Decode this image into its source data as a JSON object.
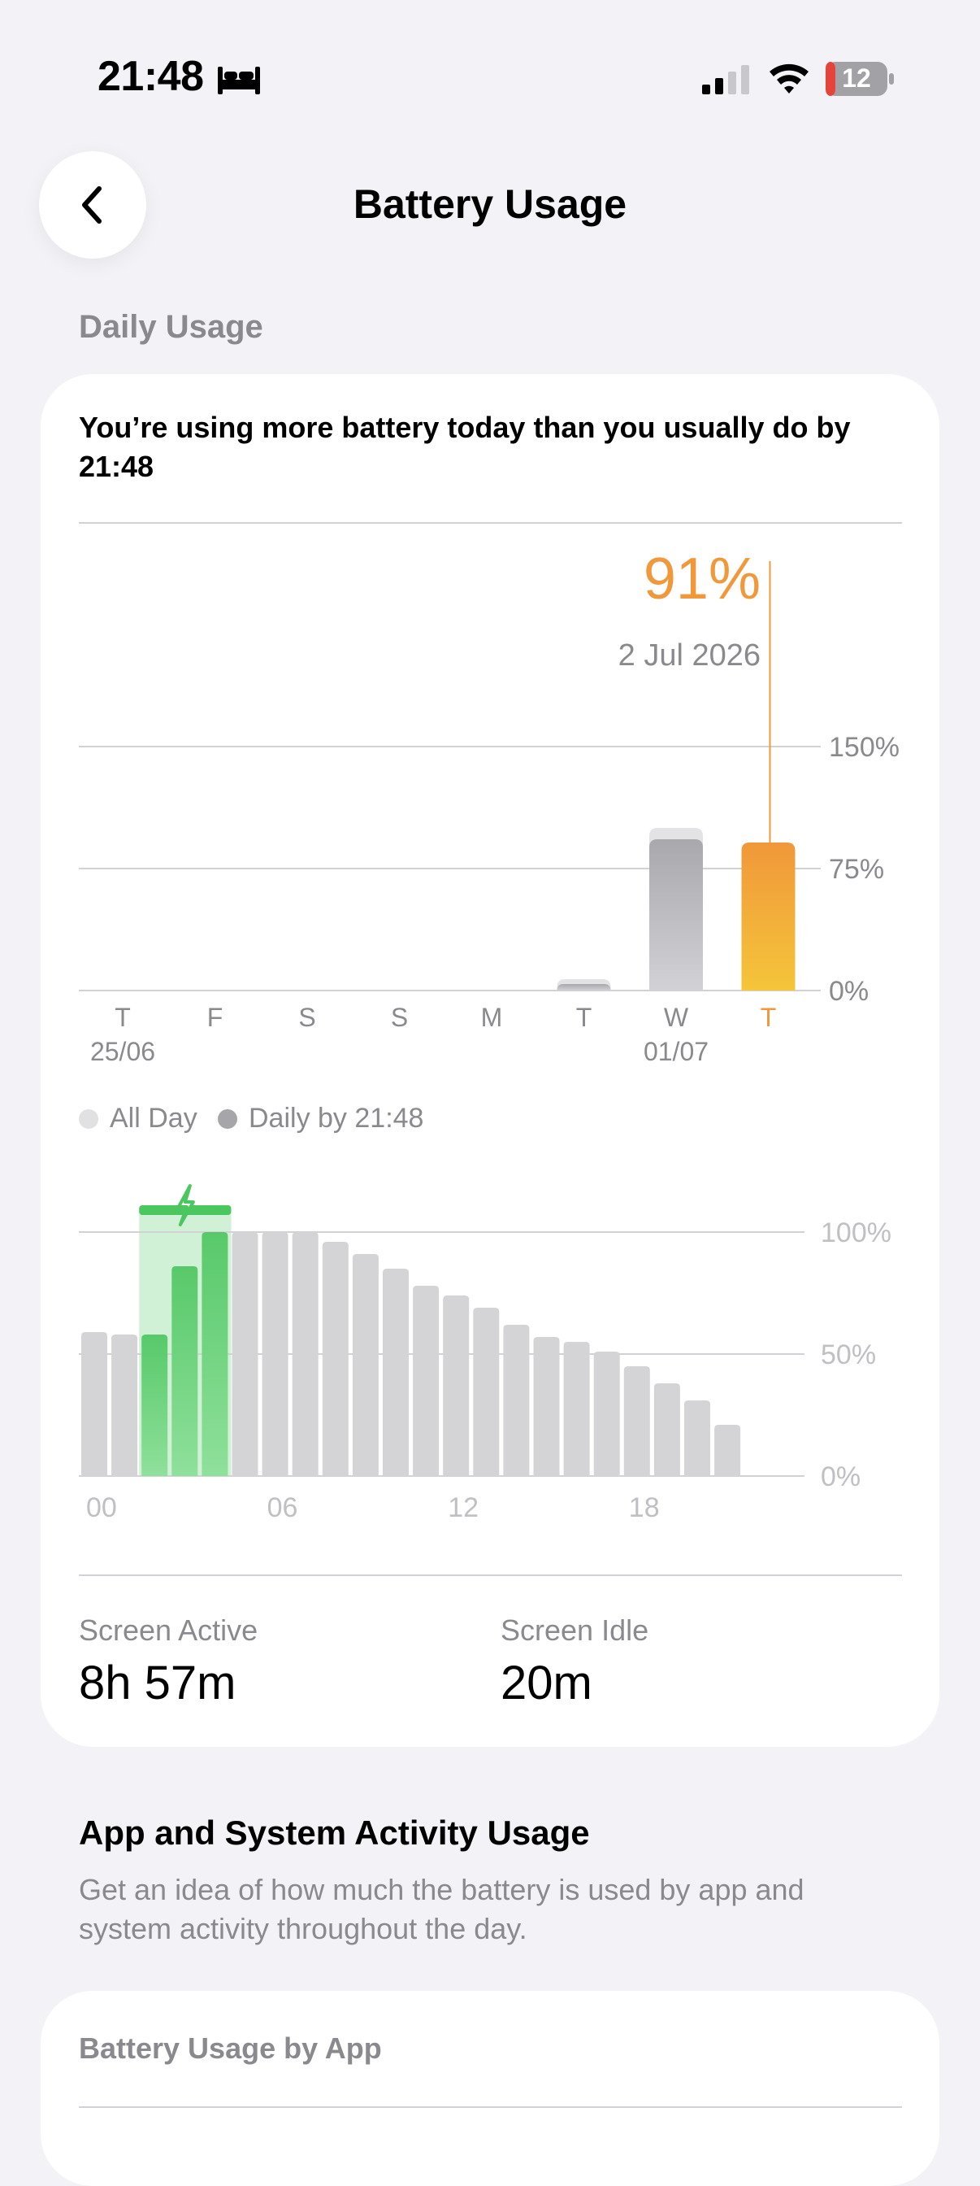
{
  "status_bar": {
    "time": "21:48",
    "battery_level": "12",
    "icons": [
      "bed-icon",
      "cellular-signal-icon",
      "wifi-icon",
      "battery-icon"
    ]
  },
  "nav": {
    "title": "Battery Usage",
    "back_icon": "chevron-left-icon"
  },
  "daily_usage": {
    "section_label": "Daily Usage",
    "headline": "You’re using more battery today than you usually do by 21:48",
    "selected_value": "91%",
    "selected_date": "2 Jul 2026",
    "legend": {
      "all_day": "All Day",
      "daily_by": "Daily by 21:48"
    }
  },
  "stats": {
    "screen_active_label": "Screen Active",
    "screen_active_value": "8h 57m",
    "screen_idle_label": "Screen Idle",
    "screen_idle_value": "20m"
  },
  "activity": {
    "title": "App and System Activity Usage",
    "subtitle": "Get an idea of how much the battery is used by app and system activity throughout the day.",
    "by_app_label": "Battery Usage by App"
  },
  "colors": {
    "accent_orange": "#f0983a",
    "accent_yellow": "#f5c53a",
    "bar_gray": "#b7b7bb",
    "charge_green": "#4cc760",
    "level_gray": "#d4d4d6"
  },
  "chart_data": [
    {
      "type": "bar",
      "categories": [
        "T",
        "F",
        "S",
        "S",
        "M",
        "T",
        "W",
        "T"
      ],
      "date_labels": [
        "25/06",
        "",
        "",
        "",
        "",
        "",
        "01/07",
        ""
      ],
      "series": [
        {
          "name": "All Day",
          "values": [
            0,
            0,
            0,
            0,
            0,
            7,
            100,
            91
          ]
        },
        {
          "name": "Daily by 21:48",
          "values": [
            0,
            0,
            0,
            0,
            0,
            4,
            93,
            91
          ]
        }
      ],
      "yticks": [
        "150%",
        "75%",
        "0%"
      ],
      "ylim": [
        0,
        225
      ],
      "highlight_index": 7,
      "title": "",
      "xlabel": "",
      "ylabel": ""
    },
    {
      "type": "bar",
      "x": [
        0,
        1,
        2,
        3,
        4,
        5,
        6,
        7,
        8,
        9,
        10,
        11,
        12,
        13,
        14,
        15,
        16,
        17,
        18,
        19,
        20,
        21
      ],
      "xtick_labels": [
        "00",
        "06",
        "12",
        "18"
      ],
      "xtick_positions": [
        0,
        6,
        12,
        18
      ],
      "values": [
        59,
        58,
        58,
        86,
        100,
        100,
        100,
        100,
        96,
        91,
        85,
        78,
        74,
        69,
        62,
        57,
        55,
        51,
        45,
        38,
        31,
        21
      ],
      "charging_hours": [
        2,
        3,
        4
      ],
      "yticks": [
        "100%",
        "50%",
        "0%"
      ],
      "ylim": [
        0,
        100
      ],
      "title": "",
      "xlabel": "",
      "ylabel": ""
    }
  ]
}
